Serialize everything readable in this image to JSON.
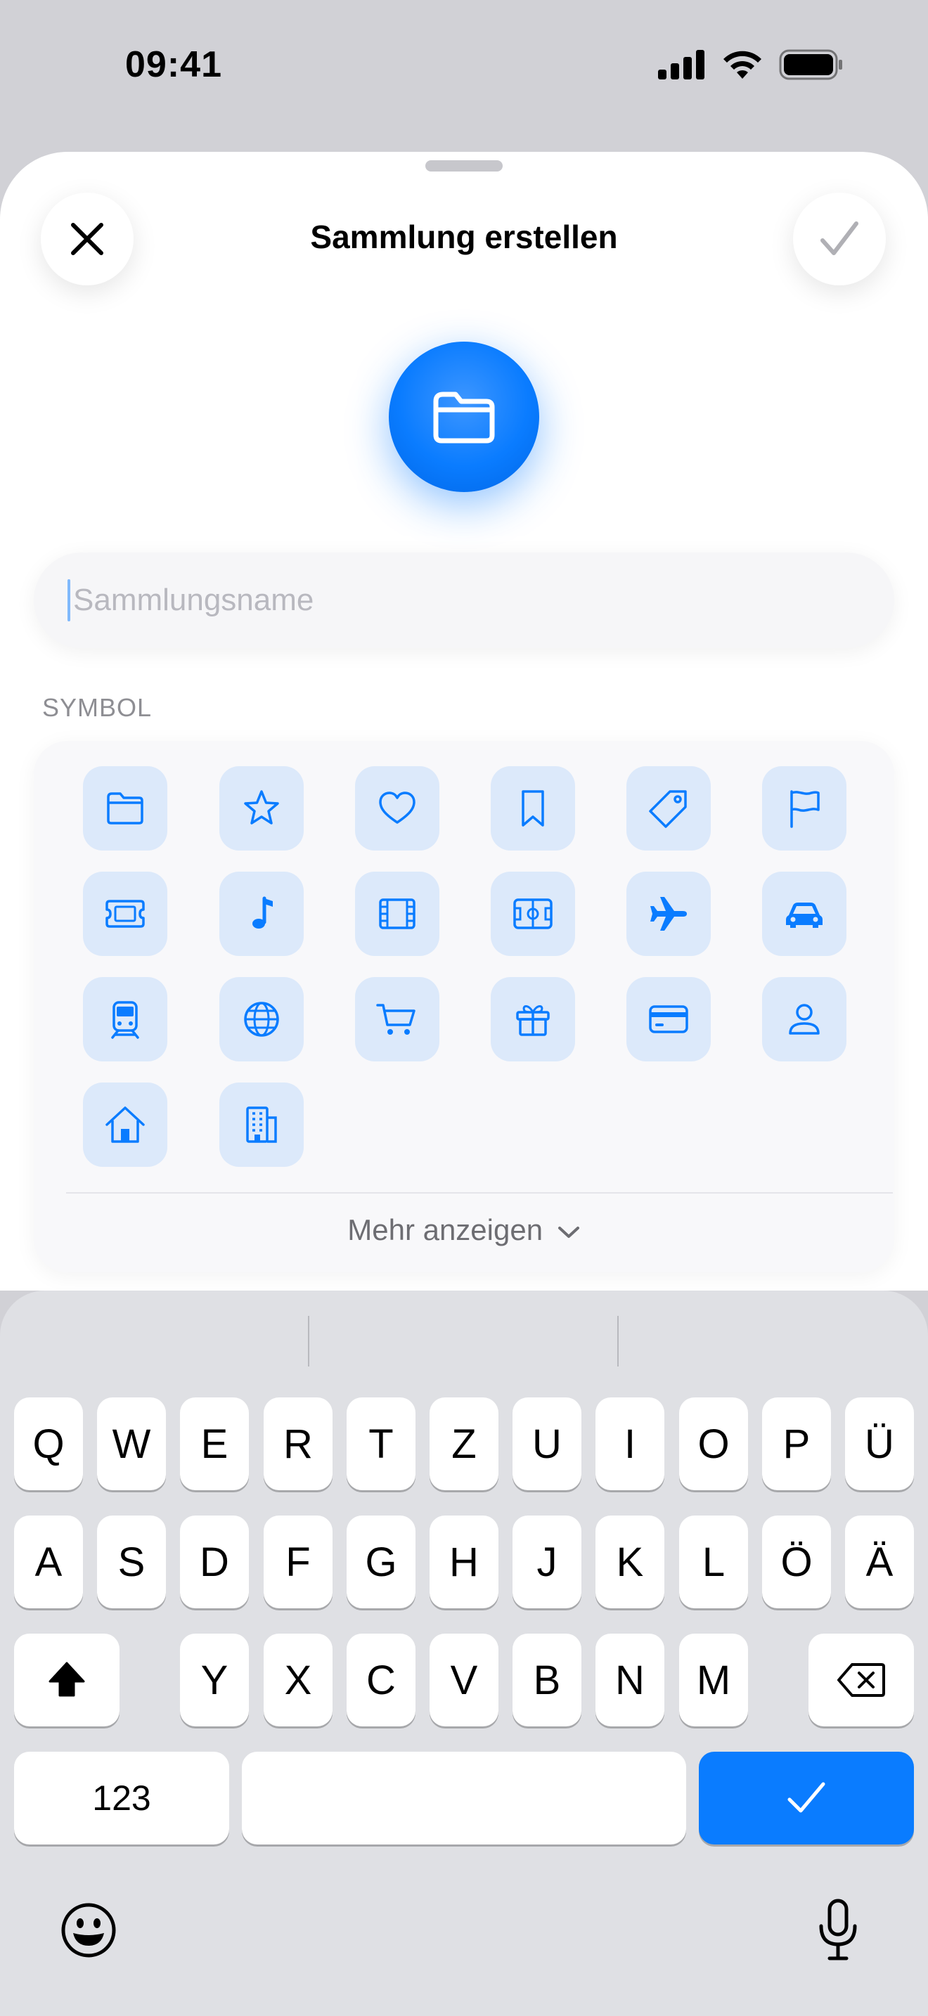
{
  "status": {
    "time": "09:41"
  },
  "sheet": {
    "title": "Sammlung erstellen",
    "close_icon": "xmark-icon",
    "done_icon": "checkmark-icon",
    "hero_icon": "folder-icon",
    "accent": "#0A7CFF"
  },
  "name_field": {
    "placeholder": "Sammlungsname",
    "value": ""
  },
  "symbols": {
    "section_label": "SYMBOL",
    "icons": [
      "folder",
      "star",
      "heart",
      "bookmark",
      "tag",
      "flag",
      "ticket",
      "music-note",
      "film",
      "soccer-field",
      "airplane",
      "car",
      "tram",
      "globe",
      "cart",
      "gift",
      "credit-card",
      "person",
      "house",
      "building"
    ],
    "more_label": "Mehr anzeigen"
  },
  "keyboard": {
    "row1": [
      "Q",
      "W",
      "E",
      "R",
      "T",
      "Z",
      "U",
      "I",
      "O",
      "P",
      "Ü"
    ],
    "row2": [
      "A",
      "S",
      "D",
      "F",
      "G",
      "H",
      "J",
      "K",
      "L",
      "Ö",
      "Ä"
    ],
    "row3": [
      "Y",
      "X",
      "C",
      "V",
      "B",
      "N",
      "M"
    ],
    "numbers_label": "123"
  }
}
